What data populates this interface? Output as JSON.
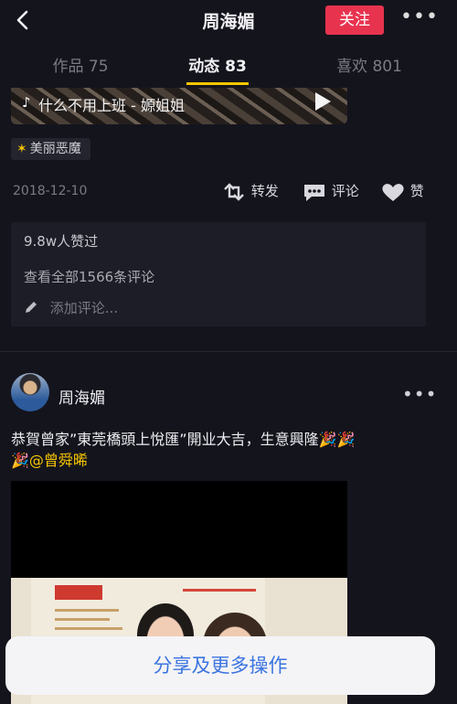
{
  "header": {
    "title": "周海媚",
    "follow_label": "关注"
  },
  "tabs": [
    {
      "label": "作品 75",
      "active": false
    },
    {
      "label": "动态 83",
      "active": true
    },
    {
      "label": "喜欢 801",
      "active": false
    }
  ],
  "post1": {
    "music_label": "什么不用上班 - 嫄姐姐",
    "tag_label": "美丽恶魔",
    "date": "2018-12-10",
    "actions": {
      "share_label": "转发",
      "comment_label": "评论",
      "like_label": "赞"
    },
    "comments": {
      "likes_text": "9.8w人赞过",
      "view_all_text": "查看全部1566条评论",
      "add_comment_placeholder": "添加评论..."
    }
  },
  "post2": {
    "author": "周海媚",
    "caption_line1": "恭賀曾家”東莞橋頭上悅匯”開业大吉，生意興隆",
    "mention": "@曾舜晞"
  },
  "share_sheet": {
    "label": "分享及更多操作"
  },
  "colors": {
    "accent_yellow": "#f7c600",
    "follow_red": "#e8334f",
    "sheet_blue": "#3b74e0",
    "background": "#14141d"
  },
  "icons": [
    "back-arrow-icon",
    "more-icon",
    "music-note-icon",
    "play-icon",
    "star-icon",
    "repost-icon",
    "comment-icon",
    "heart-icon",
    "pencil-icon",
    "party-popper-icon"
  ]
}
